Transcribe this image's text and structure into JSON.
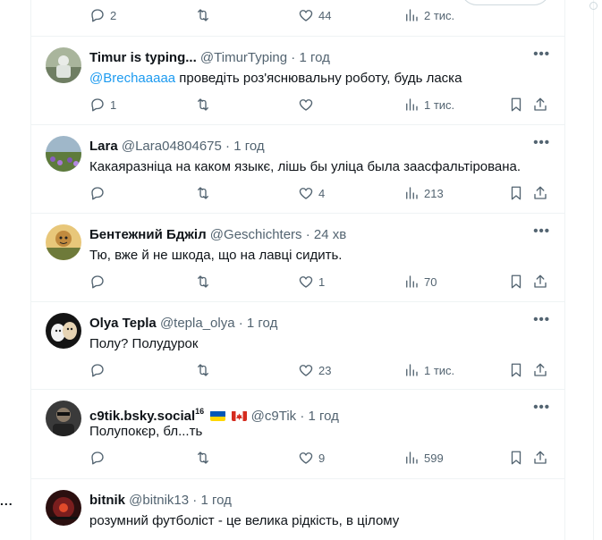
{
  "side": {
    "dots": "..."
  },
  "top_partial": {
    "replies": "2",
    "likes": "44",
    "views": "2 тис."
  },
  "tweets": [
    {
      "name": "Timur is typing...",
      "handle": "@TimurTyping",
      "sep": "·",
      "time": "1 год",
      "mention": "@Brechaaaaa",
      "text": " проведіть роз'яснювальну роботу, будь ласка",
      "replies": "1",
      "retweets": "",
      "likes": "",
      "views": "1 тис."
    },
    {
      "name": "Lara",
      "handle": "@Lara04804675",
      "sep": "·",
      "time": "1 год",
      "text": "Какаяразніца на каком языкє, лішь бы уліца была заасфальтірована.",
      "replies": "",
      "retweets": "",
      "likes": "4",
      "views": "213"
    },
    {
      "name": "Бентежний Бджіл",
      "handle": "@Geschichters",
      "sep": "·",
      "time": "24 хв",
      "text": "Тю, вже й не шкода, що на лавці сидить.",
      "replies": "",
      "retweets": "",
      "likes": "1",
      "views": "70"
    },
    {
      "name": "Olya Tepla",
      "handle": "@tepla_olya",
      "sep": "·",
      "time": "1 год",
      "text": "Полу? Полудурок",
      "replies": "",
      "retweets": "",
      "likes": "23",
      "views": "1 тис."
    },
    {
      "name": "c9tik.bsky.social",
      "badge": "16",
      "handle": "@c9Tik",
      "sep": "·",
      "time": "1 год",
      "text": "Полупокєр, бл...ть",
      "replies": "",
      "retweets": "",
      "likes": "9",
      "views": "599"
    },
    {
      "name": "bitnik",
      "handle": "@bitnik13",
      "sep": "·",
      "time": "1 год",
      "text": "розумний футболіст - це велика рідкість, в цілому"
    }
  ],
  "more_label": "•••",
  "icons": [
    "reply-icon",
    "retweet-icon",
    "heart-icon",
    "views-icon",
    "bookmark-icon",
    "share-icon"
  ],
  "colors": {
    "accent": "#1d9bf0",
    "secondary_text": "#536471",
    "border": "#eff3f4"
  }
}
